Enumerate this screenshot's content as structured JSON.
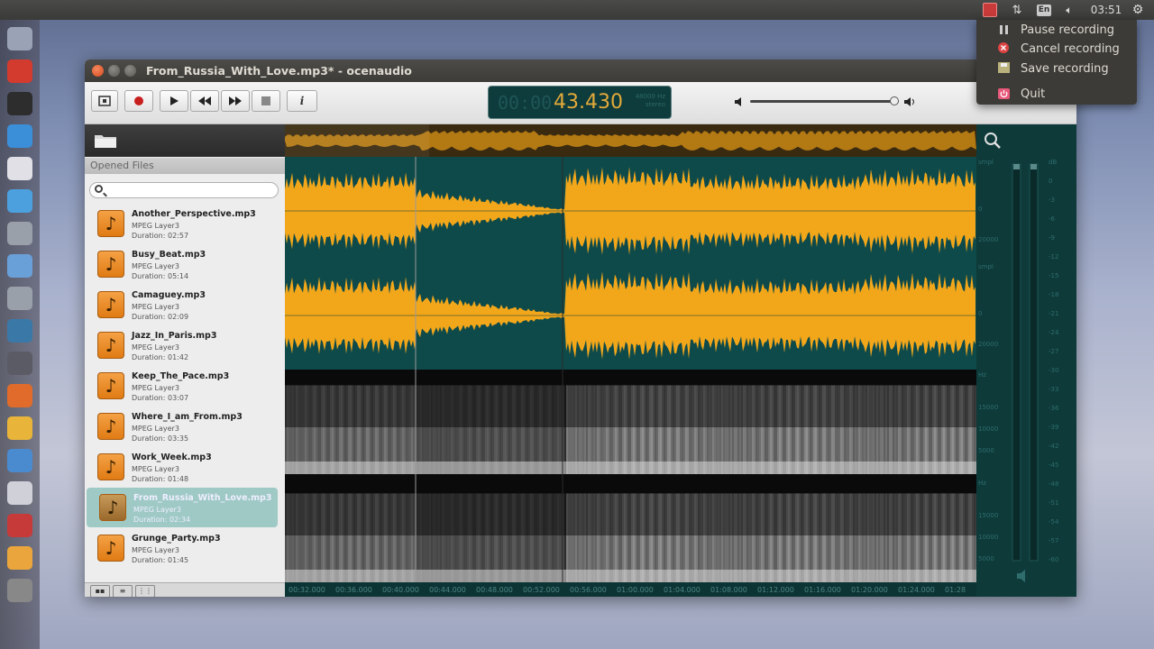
{
  "panel": {
    "clock": "03:51",
    "keyboard": "En"
  },
  "tray_menu": {
    "items": [
      {
        "label": "Pause recording",
        "icon": "pause-icon"
      },
      {
        "label": "Cancel recording",
        "icon": "cancel-icon"
      },
      {
        "label": "Save recording",
        "icon": "save-icon"
      },
      {
        "label": "Quit",
        "icon": "power-icon"
      }
    ]
  },
  "window": {
    "title": "From_Russia_With_Love.mp3* - ocenaudio"
  },
  "toolbar": {
    "display_time": "43.430",
    "display_ghost": "00:00",
    "display_rate": "48000 Hz",
    "display_channels": "stereo",
    "info_label": "i"
  },
  "sidebar": {
    "header": "Opened Files",
    "files": [
      {
        "name": "Another_Perspective.mp3",
        "format": "MPEG Layer3",
        "duration": "Duration: 02:57",
        "selected": false
      },
      {
        "name": "Busy_Beat.mp3",
        "format": "MPEG Layer3",
        "duration": "Duration: 05:14",
        "selected": false
      },
      {
        "name": "Camaguey.mp3",
        "format": "MPEG Layer3",
        "duration": "Duration: 02:09",
        "selected": false
      },
      {
        "name": "Jazz_In_Paris.mp3",
        "format": "MPEG Layer3",
        "duration": "Duration: 01:42",
        "selected": false
      },
      {
        "name": "Keep_The_Pace.mp3",
        "format": "MPEG Layer3",
        "duration": "Duration: 03:07",
        "selected": false
      },
      {
        "name": "Where_I_am_From.mp3",
        "format": "MPEG Layer3",
        "duration": "Duration: 03:35",
        "selected": false
      },
      {
        "name": "Work_Week.mp3",
        "format": "MPEG Layer3",
        "duration": "Duration: 01:48",
        "selected": false
      },
      {
        "name": "From_Russia_With_Love.mp3",
        "format": "MPEG Layer3",
        "duration": "Duration: 02:34",
        "selected": true
      },
      {
        "name": "Grunge_Party.mp3",
        "format": "MPEG Layer3",
        "duration": "Duration: 01:45",
        "selected": false
      }
    ]
  },
  "editor": {
    "colors": {
      "wave": "#f2a71b",
      "wave_bg": "#0f4a4a",
      "spectro_bg": "#0a0a0a"
    },
    "time_ticks": [
      "00:32.000",
      "00:36.000",
      "00:40.000",
      "00:44.000",
      "00:48.000",
      "00:52.000",
      "00:56.000",
      "01:00.000",
      "01:04.000",
      "01:08.000",
      "01:12.000",
      "01:16.000",
      "01:20.000",
      "01:24.000",
      "01:28"
    ],
    "wave_scale": [
      "smpl",
      "0",
      "20000",
      "smpl",
      "0",
      "20000"
    ],
    "spec_scale": [
      "Hz",
      "15000",
      "10000",
      "5000",
      "Hz",
      "15000",
      "10000",
      "5000"
    ],
    "db_scale": [
      "dB",
      "0",
      "-3",
      "-6",
      "-9",
      "-12",
      "-15",
      "-18",
      "-21",
      "-24",
      "-27",
      "-30",
      "-33",
      "-36",
      "-39",
      "-42",
      "-45",
      "-48",
      "-51",
      "-54",
      "-57",
      "-60"
    ]
  }
}
